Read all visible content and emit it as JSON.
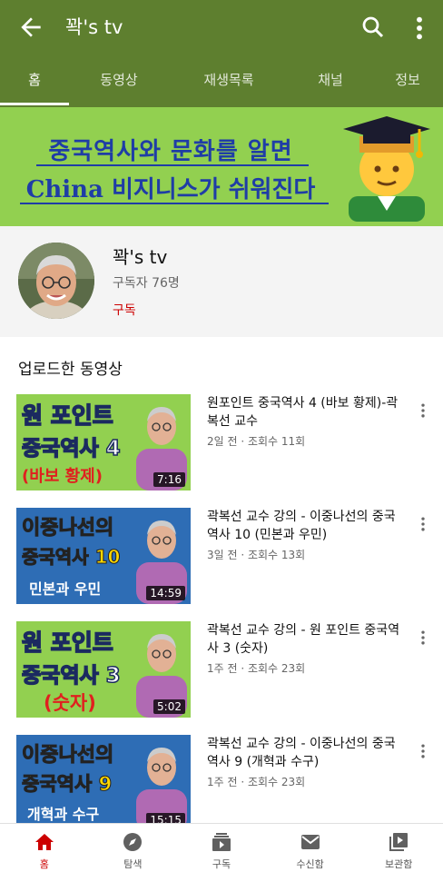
{
  "header": {
    "title": "꽉's tv",
    "tabs": [
      "홈",
      "동영상",
      "재생목록",
      "채널",
      "정보"
    ]
  },
  "banner": {
    "line1": "중국역사와 문화를 알면",
    "line2": "China 비지니스가 쉬워진다"
  },
  "channel": {
    "name": "꽉's tv",
    "subscribers": "구독자 76명",
    "subscribe_label": "구독"
  },
  "section_title": "업로드한 동영상",
  "videos": [
    {
      "thumb_line1": "원 포인트",
      "thumb_line2": "중국역사 4",
      "thumb_line3": "(바보 황제)",
      "duration": "7:16",
      "title": "원포인트 중국역사 4 (바보 황제)-곽복선 교수",
      "meta": "2일 전 · 조회수 11회"
    },
    {
      "thumb_line1": "이중나선의",
      "thumb_line2": "중국역사 10",
      "thumb_line3": "민본과 우민",
      "duration": "14:59",
      "title": "곽복선 교수 강의 - 이중나선의 중국역사 10 (민본과 우민)",
      "meta": "3일 전 · 조회수 13회"
    },
    {
      "thumb_line1": "원 포인트",
      "thumb_line2": "중국역사 3",
      "thumb_line3": "(숫자)",
      "duration": "5:02",
      "title": "곽복선 교수 강의 - 원 포인트 중국역사 3 (숫자)",
      "meta": "1주 전 · 조회수 23회"
    },
    {
      "thumb_line1": "이중나선의",
      "thumb_line2": "중국역사 9",
      "thumb_line3": "개혁과 수구",
      "duration": "15:15",
      "title": "곽복선 교수 강의 - 이중나선의 중국역사 9 (개혁과 수구)",
      "meta": "1주 전 · 조회수 23회"
    }
  ],
  "bottom_nav": [
    "홈",
    "탐색",
    "구독",
    "수신함",
    "보관함"
  ],
  "colors": {
    "appbar": "#5e7f2f",
    "banner_bg": "#92d050",
    "banner_text": "#1f3da6",
    "accent": "#cc0000"
  }
}
